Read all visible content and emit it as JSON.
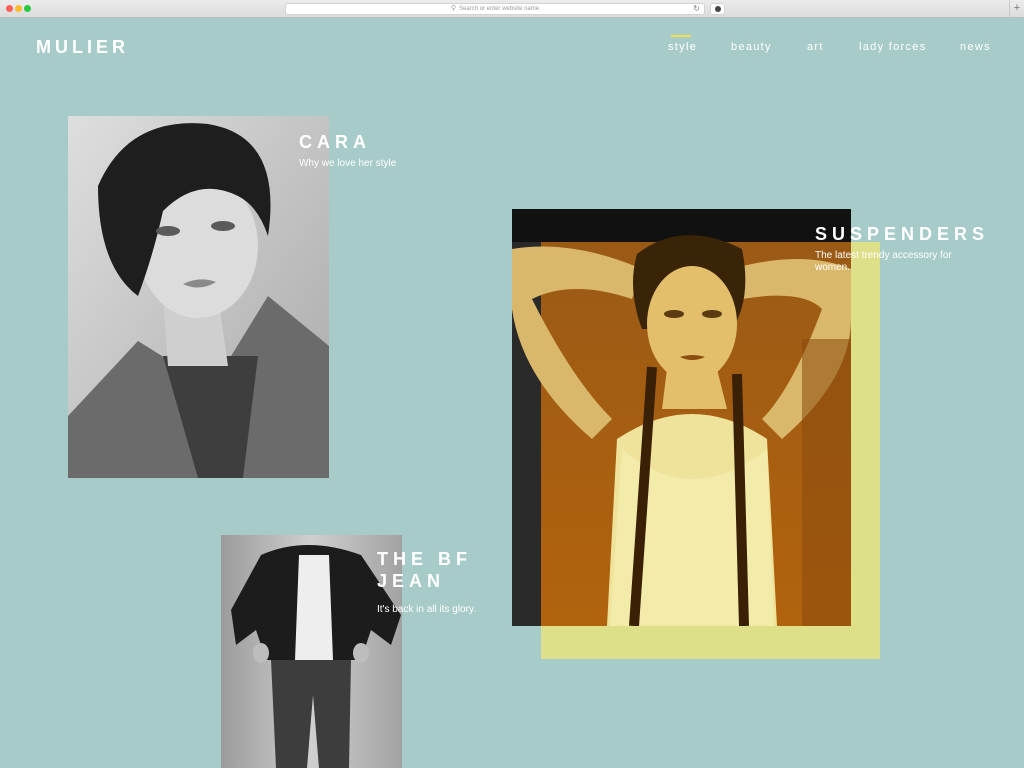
{
  "browser": {
    "url_placeholder": "Search or enter website name",
    "icons": [
      "search-icon",
      "reload-icon",
      "download-icon",
      "plus-icon"
    ]
  },
  "header": {
    "logo": "MULIER",
    "nav": [
      {
        "label": "style",
        "active": true
      },
      {
        "label": "beauty",
        "active": false
      },
      {
        "label": "art",
        "active": false
      },
      {
        "label": "lady forces",
        "active": false
      },
      {
        "label": "news",
        "active": false
      }
    ]
  },
  "articles": [
    {
      "title": "CARA",
      "subtitle": "Why we love her style"
    },
    {
      "title": "SUSPENDERS",
      "subtitle": "The latest trendy accessory for women."
    },
    {
      "title": "THE BF JEAN",
      "subtitle": "It's back in all its glory."
    }
  ],
  "colors": {
    "background": "#a7cbc8",
    "accent": "#f1de4e",
    "highlight_block": "#dde089",
    "text": "#ffffff"
  }
}
